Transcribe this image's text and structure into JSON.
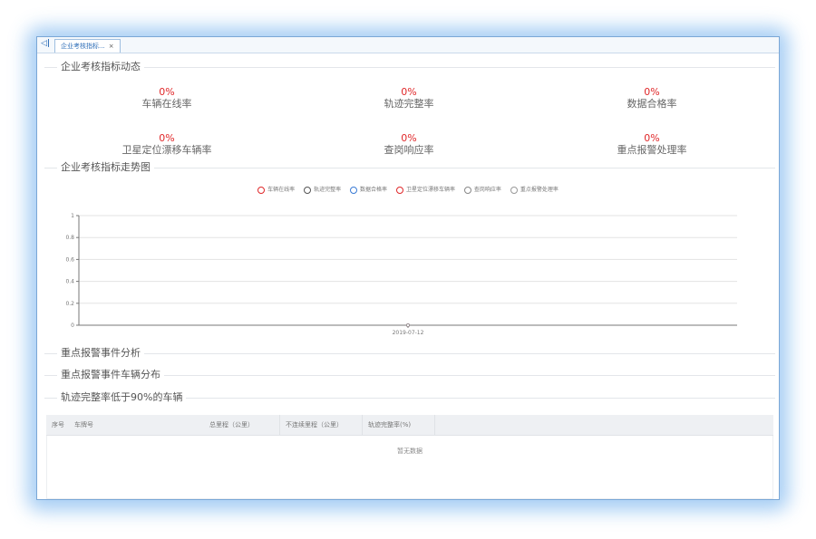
{
  "tabbar": {
    "back_icon_glyph": "◁|",
    "tab_label": "企业考核指标...",
    "tab_close": "×"
  },
  "sections": {
    "indicators": "企业考核指标动态",
    "trend": "企业考核指标走势图",
    "alarm_analysis": "重点报警事件分析",
    "alarm_vehicle": "重点报警事件车辆分布",
    "low_track": "轨迹完整率低于90%的车辆"
  },
  "metrics": [
    {
      "value": "0%",
      "label": "车辆在线率"
    },
    {
      "value": "0%",
      "label": "轨迹完整率"
    },
    {
      "value": "0%",
      "label": "数据合格率"
    },
    {
      "value": "0%",
      "label": "卫星定位漂移车辆率"
    },
    {
      "value": "0%",
      "label": "查岗响应率"
    },
    {
      "value": "0%",
      "label": "重点报警处理率"
    }
  ],
  "chart_data": {
    "type": "line",
    "categories": [
      "2019-07-12"
    ],
    "series": [
      {
        "name": "车辆在线率",
        "values": [
          0
        ]
      },
      {
        "name": "轨迹完整率",
        "values": [
          0
        ]
      },
      {
        "name": "数据合格率",
        "values": [
          0
        ]
      },
      {
        "name": "卫星定位漂移车辆率",
        "values": [
          0
        ]
      },
      {
        "name": "查岗响应率",
        "values": [
          0
        ]
      },
      {
        "name": "重点报警处理率",
        "values": [
          0
        ]
      }
    ],
    "ylim": [
      0,
      1
    ],
    "yticks": [
      "0",
      "0.2",
      "0.4",
      "0.6",
      "0.8",
      "1"
    ],
    "grid": true,
    "legend_position": "top-center",
    "colors": [
      "#e0282a",
      "#555555",
      "#3a7bd5",
      "#e0282a",
      "#888888",
      "#999999"
    ]
  },
  "table": {
    "columns": [
      "序号",
      "车牌号",
      "总里程（公里）",
      "不连续里程（公里）",
      "轨迹完整率(%)"
    ],
    "empty_text": "暂无数据"
  }
}
